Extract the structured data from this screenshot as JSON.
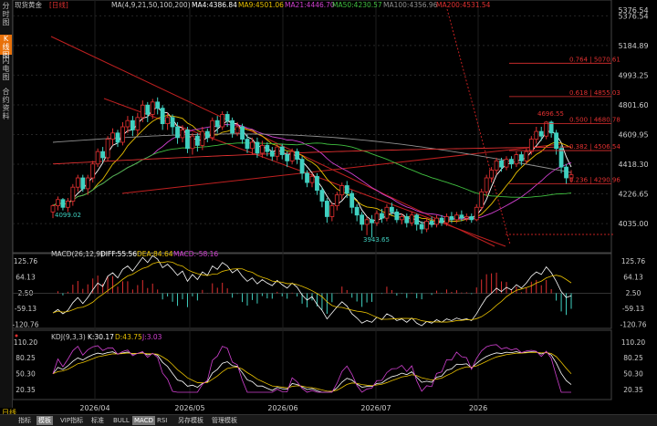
{
  "left_tabs": [
    {
      "label": "分时图",
      "active": false
    },
    {
      "label": "K线图",
      "active": true
    },
    {
      "label": "闪电图",
      "active": false
    },
    {
      "label": "合约资料",
      "active": false
    }
  ],
  "main": {
    "instrument": "现货黄金",
    "period": "[日线]",
    "ma_label": "MA(4,9,21,50,100,200)",
    "ma4": "MA4:4386.84",
    "ma9": "MA9:4501.06",
    "ma21": "MA21:4446.70",
    "ma50": "MA50:4230.57",
    "ma100": "MA100:4356.96",
    "ma200": "MA200:4531.54",
    "top_price": "5376.54",
    "low_label": "4099.02",
    "low2_label": "3943.65",
    "high_label": "4696.55"
  },
  "fib_labels": [
    {
      "text": "0.764 | 5070.61",
      "price": 5070.61
    },
    {
      "text": "0.618 | 4855.03",
      "price": 4855.03
    },
    {
      "text": "0.500 | 4680.78",
      "price": 4680.78
    },
    {
      "text": "0.382 | 4506.54",
      "price": 4506.54
    },
    {
      "text": "0.236 | 4290.96",
      "price": 4290.96
    }
  ],
  "macd": {
    "label": "MACD(26,12,9)",
    "diff": "DIFF:55.56",
    "dea": "DEA:84.64",
    "macd": "MACD:-58.16",
    "ticks": [
      "125.76",
      "64.13",
      "2.50",
      "-59.13",
      "-120.76"
    ]
  },
  "kdj": {
    "label": "KDJ(9,3,3)",
    "k": "K:30.17",
    "d": "D:43.75",
    "j": "J:3.03",
    "ticks": [
      "110.20",
      "80.25",
      "50.30",
      "20.35"
    ]
  },
  "time_axis": [
    "2026/04",
    "2026/05",
    "2026/06",
    "2026/07",
    "2026"
  ],
  "bottom_tabs": [
    {
      "label": "指标",
      "active": false
    },
    {
      "label": "模板",
      "active": true
    },
    {
      "label": "VIP指标",
      "active": false
    },
    {
      "label": "标准",
      "active": false
    },
    {
      "label": "BULL",
      "active": false
    },
    {
      "label": "MACD",
      "active": true
    },
    {
      "label": "RSI",
      "active": false
    },
    {
      "label": "另存模板",
      "active": false
    },
    {
      "label": "管理模板",
      "active": false
    }
  ],
  "time_tab": "日线",
  "chart_data": {
    "type": "candlestick",
    "y_ticks": [
      5376.54,
      5184.89,
      4993.25,
      4801.6,
      4609.95,
      4418.3,
      4226.65,
      4035.0
    ],
    "ylim": [
      3900,
      5420
    ],
    "candles": [
      [
        4110,
        4150,
        4070,
        4160
      ],
      [
        4150,
        4190,
        4120,
        4210
      ],
      [
        4190,
        4140,
        4120,
        4200
      ],
      [
        4140,
        4180,
        4110,
        4200
      ],
      [
        4180,
        4270,
        4150,
        4290
      ],
      [
        4270,
        4330,
        4240,
        4350
      ],
      [
        4330,
        4260,
        4240,
        4350
      ],
      [
        4260,
        4330,
        4220,
        4350
      ],
      [
        4330,
        4420,
        4300,
        4440
      ],
      [
        4420,
        4500,
        4400,
        4520
      ],
      [
        4500,
        4460,
        4430,
        4530
      ],
      [
        4460,
        4580,
        4440,
        4600
      ],
      [
        4580,
        4620,
        4540,
        4650
      ],
      [
        4620,
        4560,
        4530,
        4640
      ],
      [
        4560,
        4660,
        4540,
        4690
      ],
      [
        4660,
        4700,
        4620,
        4730
      ],
      [
        4700,
        4640,
        4600,
        4730
      ],
      [
        4640,
        4720,
        4610,
        4750
      ],
      [
        4720,
        4800,
        4690,
        4830
      ],
      [
        4800,
        4740,
        4690,
        4820
      ],
      [
        4740,
        4820,
        4710,
        4840
      ],
      [
        4820,
        4780,
        4740,
        4850
      ],
      [
        4780,
        4680,
        4640,
        4800
      ],
      [
        4680,
        4720,
        4640,
        4750
      ],
      [
        4720,
        4660,
        4610,
        4740
      ],
      [
        4660,
        4590,
        4550,
        4690
      ],
      [
        4590,
        4640,
        4560,
        4670
      ],
      [
        4640,
        4520,
        4490,
        4660
      ],
      [
        4520,
        4600,
        4480,
        4620
      ],
      [
        4600,
        4540,
        4500,
        4620
      ],
      [
        4540,
        4630,
        4510,
        4660
      ],
      [
        4630,
        4590,
        4560,
        4650
      ],
      [
        4590,
        4700,
        4570,
        4720
      ],
      [
        4700,
        4660,
        4620,
        4730
      ],
      [
        4660,
        4740,
        4640,
        4760
      ],
      [
        4740,
        4700,
        4660,
        4760
      ],
      [
        4700,
        4620,
        4590,
        4720
      ],
      [
        4620,
        4660,
        4600,
        4690
      ],
      [
        4660,
        4580,
        4550,
        4680
      ],
      [
        4580,
        4520,
        4490,
        4610
      ],
      [
        4520,
        4560,
        4480,
        4590
      ],
      [
        4560,
        4490,
        4460,
        4590
      ],
      [
        4490,
        4540,
        4460,
        4570
      ],
      [
        4540,
        4500,
        4470,
        4560
      ],
      [
        4500,
        4470,
        4440,
        4530
      ],
      [
        4470,
        4530,
        4440,
        4550
      ],
      [
        4530,
        4480,
        4450,
        4550
      ],
      [
        4480,
        4440,
        4400,
        4500
      ],
      [
        4440,
        4500,
        4420,
        4520
      ],
      [
        4500,
        4450,
        4420,
        4520
      ],
      [
        4450,
        4360,
        4320,
        4470
      ],
      [
        4360,
        4300,
        4270,
        4380
      ],
      [
        4300,
        4340,
        4270,
        4360
      ],
      [
        4340,
        4250,
        4220,
        4360
      ],
      [
        4250,
        4180,
        4140,
        4270
      ],
      [
        4180,
        4080,
        4040,
        4200
      ],
      [
        4080,
        4150,
        4050,
        4170
      ],
      [
        4150,
        4220,
        4120,
        4240
      ],
      [
        4220,
        4280,
        4190,
        4300
      ],
      [
        4280,
        4230,
        4200,
        4310
      ],
      [
        4230,
        4140,
        4100,
        4250
      ],
      [
        4140,
        4090,
        4050,
        4160
      ],
      [
        4090,
        4030,
        3990,
        4110
      ],
      [
        4030,
        4060,
        3960,
        4080
      ],
      [
        4060,
        4040,
        3944,
        4090
      ],
      [
        4040,
        4100,
        4020,
        4120
      ],
      [
        4100,
        4070,
        4040,
        4130
      ],
      [
        4070,
        4140,
        4050,
        4160
      ],
      [
        4140,
        4110,
        4090,
        4170
      ],
      [
        4110,
        4060,
        4040,
        4130
      ],
      [
        4060,
        4080,
        4030,
        4100
      ],
      [
        4080,
        4040,
        4010,
        4100
      ],
      [
        4040,
        4090,
        4020,
        4110
      ],
      [
        4090,
        4030,
        3990,
        4100
      ],
      [
        4030,
        4000,
        3970,
        4050
      ],
      [
        4000,
        4050,
        3980,
        4070
      ],
      [
        4050,
        4030,
        4010,
        4080
      ],
      [
        4030,
        4070,
        4010,
        4090
      ],
      [
        4070,
        4040,
        4020,
        4090
      ],
      [
        4040,
        4080,
        4020,
        4100
      ],
      [
        4080,
        4060,
        4040,
        4110
      ],
      [
        4060,
        4090,
        4040,
        4110
      ],
      [
        4090,
        4070,
        4050,
        4120
      ],
      [
        4070,
        4080,
        4050,
        4100
      ],
      [
        4080,
        4060,
        4040,
        4100
      ],
      [
        4060,
        4140,
        4050,
        4160
      ],
      [
        4140,
        4240,
        4120,
        4260
      ],
      [
        4240,
        4330,
        4210,
        4350
      ],
      [
        4330,
        4380,
        4300,
        4400
      ],
      [
        4380,
        4440,
        4350,
        4460
      ],
      [
        4440,
        4400,
        4370,
        4460
      ],
      [
        4400,
        4450,
        4380,
        4470
      ],
      [
        4450,
        4420,
        4390,
        4470
      ],
      [
        4420,
        4480,
        4400,
        4500
      ],
      [
        4480,
        4440,
        4410,
        4500
      ],
      [
        4440,
        4500,
        4420,
        4520
      ],
      [
        4500,
        4580,
        4480,
        4600
      ],
      [
        4580,
        4630,
        4550,
        4660
      ],
      [
        4630,
        4600,
        4570,
        4660
      ],
      [
        4600,
        4690,
        4580,
        4697
      ],
      [
        4690,
        4620,
        4590,
        4700
      ],
      [
        4620,
        4520,
        4480,
        4640
      ],
      [
        4520,
        4400,
        4360,
        4540
      ],
      [
        4400,
        4330,
        4290,
        4420
      ],
      [
        4330,
        4350,
        4300,
        4380
      ]
    ],
    "ma_series": [
      {
        "name": "MA4",
        "color": "#ffffff"
      },
      {
        "name": "MA9",
        "color": "#e8c000"
      },
      {
        "name": "MA21",
        "color": "#d040d0"
      },
      {
        "name": "MA50",
        "color": "#40c040"
      },
      {
        "name": "MA100",
        "color": "#909090"
      },
      {
        "name": "MA200",
        "color": "#e03030"
      }
    ],
    "colors": {
      "up": "#e03030",
      "down": "#40d0c0",
      "fib": "#e03030"
    }
  }
}
